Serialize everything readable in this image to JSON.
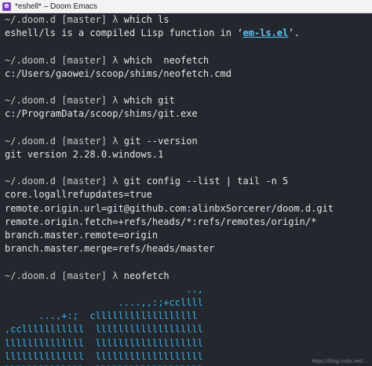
{
  "window": {
    "title": "*eshell* – Doom Emacs",
    "icon_glyph": "e"
  },
  "prompt": {
    "dir": "~/.doom.d",
    "branch": "[master]",
    "lambda": "λ"
  },
  "blocks": [
    {
      "command": "which ls",
      "output_prefix": "eshell/ls is a compiled Lisp function in ‘",
      "output_link": "em-ls.el",
      "output_suffix": "’."
    },
    {
      "command": "which  neofetch",
      "output": [
        "c:/Users/gaowei/scoop/shims/neofetch.cmd"
      ]
    },
    {
      "command": "which git",
      "output": [
        "c:/ProgramData/scoop/shims/git.exe"
      ]
    },
    {
      "command": "git --version",
      "output": [
        "git version 2.28.0.windows.1"
      ]
    },
    {
      "command": "git config --list | tail -n 5",
      "output": [
        "core.logallrefupdates=true",
        "remote.origin.url=git@github.com:alinbxSorcerer/doom.d.git",
        "remote.origin.fetch=+refs/heads/*:refs/remotes/origin/*",
        "branch.master.remote=origin",
        "branch.master.merge=refs/heads/master"
      ]
    },
    {
      "command": "neofetch",
      "output": [
        "                                ..,",
        "                    ....,,:;+ccllll",
        "      ...,+:;  cllllllllllllllllll",
        ",cclllllllllll  lllllllllllllllllll",
        "llllllllllllll  lllllllllllllllllll",
        "llllllllllllll  lllllllllllllllllll",
        "llllllllllllll  lllllllllllllllllll"
      ]
    }
  ],
  "watermark": "https://blog.csdn.net/..."
}
